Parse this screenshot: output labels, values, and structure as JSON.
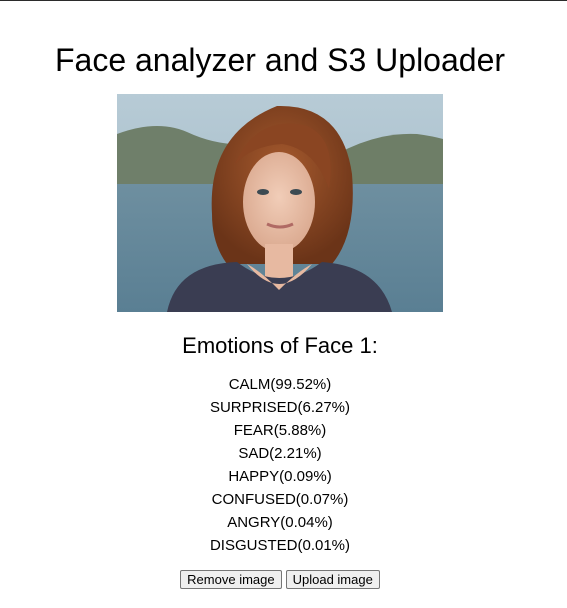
{
  "header": {
    "title": "Face analyzer and S3 Uploader"
  },
  "image": {
    "description_icon": "portrait-photo"
  },
  "results": {
    "heading": "Emotions of Face 1:",
    "emotions": [
      "CALM(99.52%)",
      "SURPRISED(6.27%)",
      "FEAR(5.88%)",
      "SAD(2.21%)",
      "HAPPY(0.09%)",
      "CONFUSED(0.07%)",
      "ANGRY(0.04%)",
      "DISGUSTED(0.01%)"
    ]
  },
  "actions": {
    "remove_label": "Remove image",
    "upload_label": "Upload image"
  }
}
